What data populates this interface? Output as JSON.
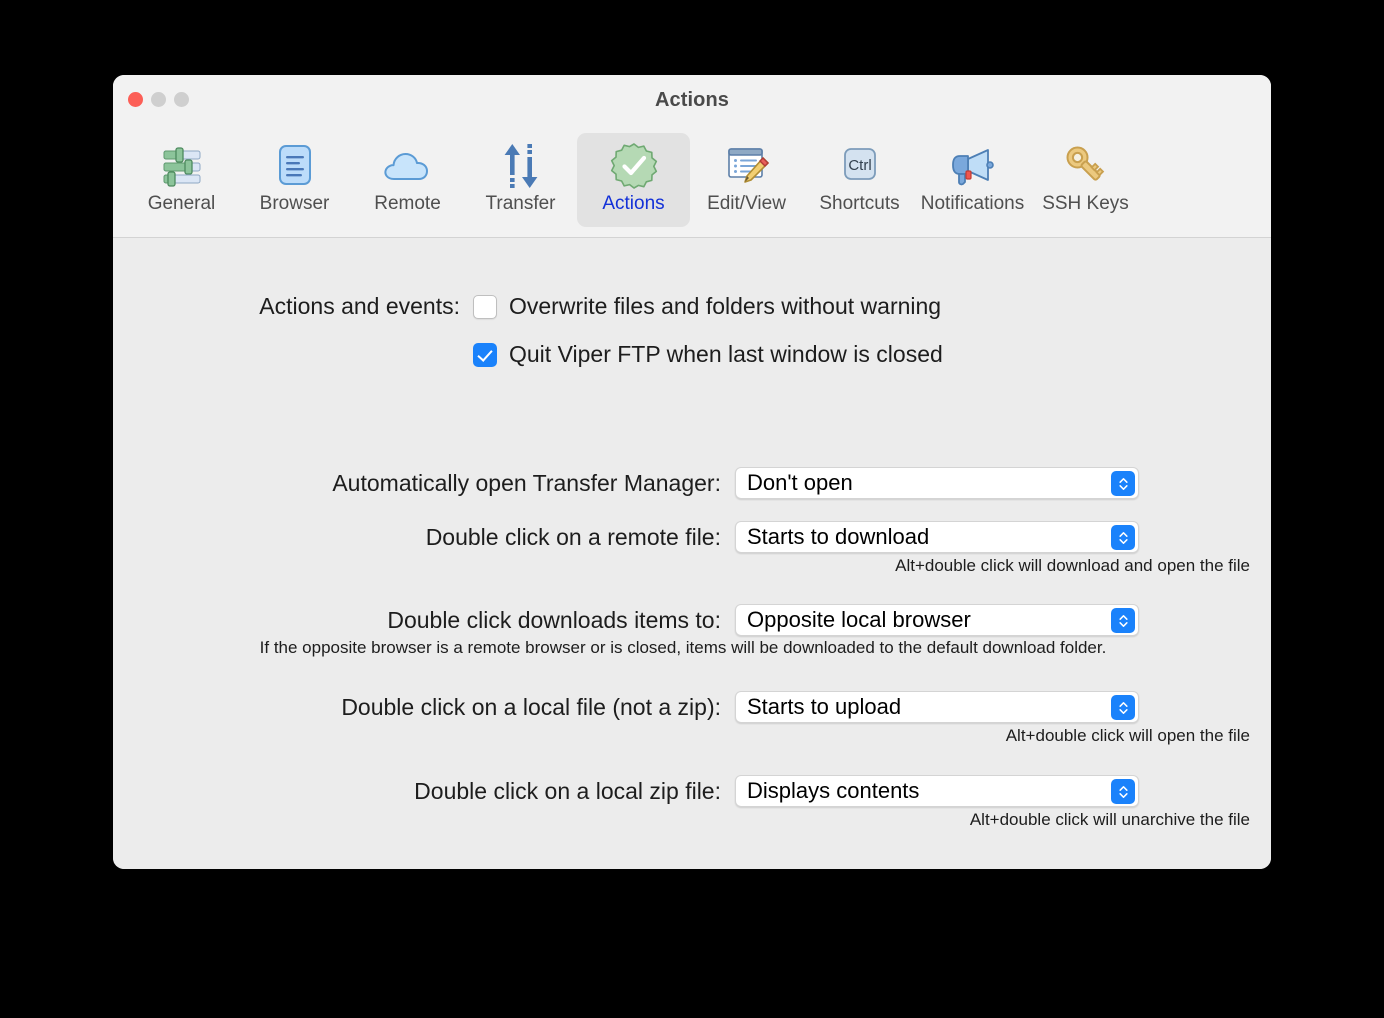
{
  "window": {
    "title": "Actions",
    "traffic_lights": [
      "close",
      "minimize",
      "maximize"
    ]
  },
  "toolbar": {
    "tabs": [
      {
        "label": "General",
        "icon": "sliders-icon",
        "selected": false
      },
      {
        "label": "Browser",
        "icon": "document-lines-icon",
        "selected": false
      },
      {
        "label": "Remote",
        "icon": "cloud-icon",
        "selected": false
      },
      {
        "label": "Transfer",
        "icon": "up-down-arrows-icon",
        "selected": false
      },
      {
        "label": "Actions",
        "icon": "green-check-badge-icon",
        "selected": true
      },
      {
        "label": "Edit/View",
        "icon": "window-pencil-icon",
        "selected": false
      },
      {
        "label": "Shortcuts",
        "icon": "ctrl-key-icon",
        "selected": false
      },
      {
        "label": "Notifications",
        "icon": "megaphone-icon",
        "selected": false
      },
      {
        "label": "SSH Keys",
        "icon": "key-icon",
        "selected": false
      }
    ]
  },
  "content": {
    "actions_and_events": {
      "label": "Actions and events:",
      "checkboxes": [
        {
          "text": "Overwrite files and folders without warning",
          "checked": false
        },
        {
          "text": "Quit Viper FTP when last window is closed",
          "checked": true
        }
      ]
    },
    "settings": [
      {
        "label": "Automatically open Transfer Manager:",
        "value": "Don't open",
        "hint": ""
      },
      {
        "label": "Double click on a remote file:",
        "value": "Starts to download",
        "hint": "Alt+double click will download and open the file"
      },
      {
        "label": "Double click downloads items to:",
        "value": "Opposite local browser",
        "hint": "If the opposite browser is a remote browser or is closed, items will be downloaded to the default download folder."
      },
      {
        "label": "Double click on a local file (not a zip):",
        "value": "Starts to upload",
        "hint": "Alt+double click will open the file"
      },
      {
        "label": "Double click on a local zip file:",
        "value": "Displays contents",
        "hint": "Alt+double click will unarchive the file"
      }
    ]
  },
  "colors": {
    "accent_blue": "#1a82fb",
    "selected_tab_text": "#1331d8",
    "window_background": "#ececec",
    "toolbar_background": "#f2f2f2",
    "close_light": "#fc5f57",
    "inactive_light": "#cfcfcf"
  }
}
